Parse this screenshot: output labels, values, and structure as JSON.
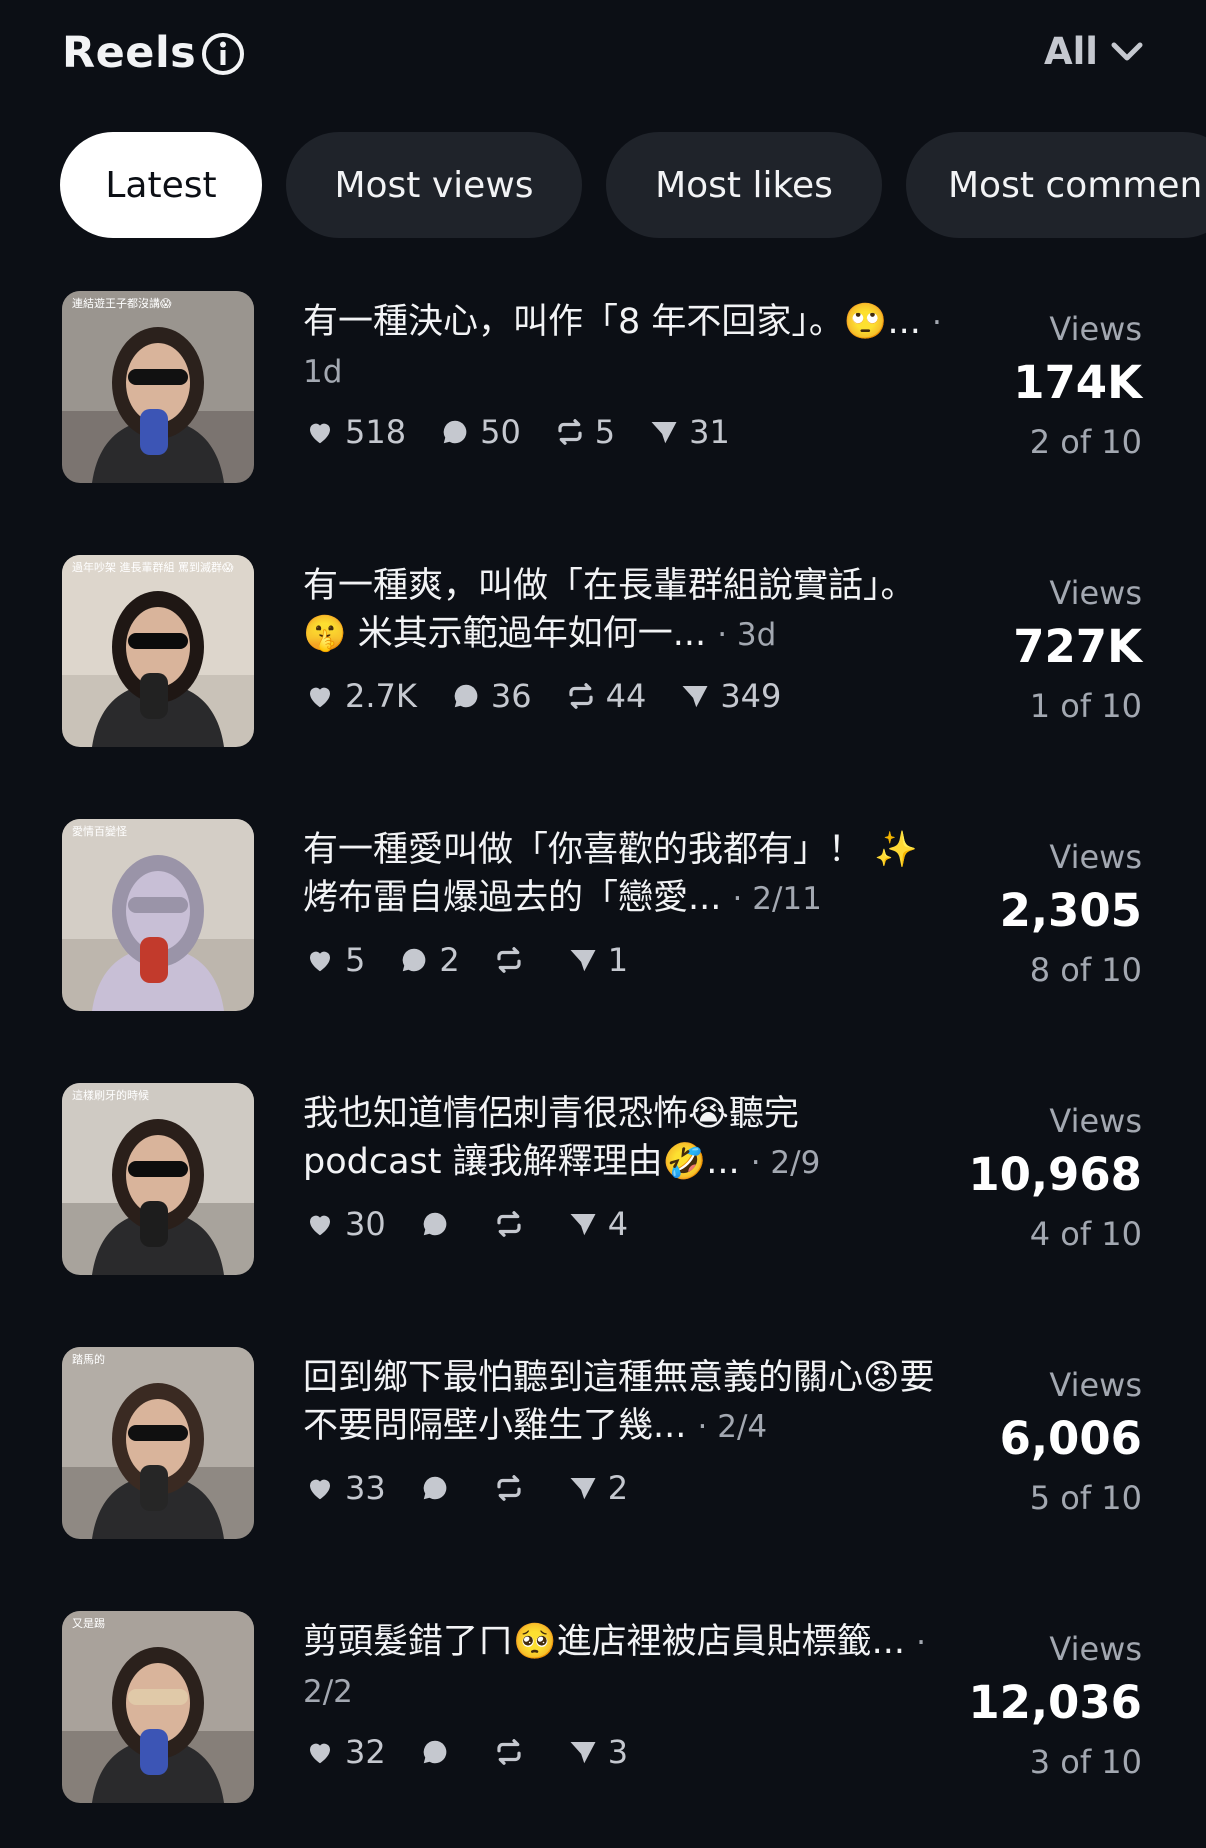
{
  "header": {
    "title": "Reels",
    "filter_label": "All"
  },
  "tabs": [
    {
      "label": "Latest",
      "active": true
    },
    {
      "label": "Most views",
      "active": false
    },
    {
      "label": "Most likes",
      "active": false
    },
    {
      "label": "Most commen",
      "active": false
    }
  ],
  "labels": {
    "views": "Views"
  },
  "reels": [
    {
      "caption": "有一種決心，叫作「8 年不回家」。🙄...",
      "date": "· 1d",
      "likes": "518",
      "comments": "50",
      "reposts": "5",
      "shares": "31",
      "views": "174K",
      "rank": "2 of 10"
    },
    {
      "caption": "有一種爽，叫做「在長輩群組說實話」。 🤫 米其示範過年如何一...",
      "date": "· 3d",
      "likes": "2.7K",
      "comments": "36",
      "reposts": "44",
      "shares": "349",
      "views": "727K",
      "rank": "1 of 10"
    },
    {
      "caption": "有一種愛叫做「你喜歡的我都有」！ ✨ 烤布雷自爆過去的「戀愛...",
      "date": "· 2/11",
      "likes": "5",
      "comments": "2",
      "reposts": "",
      "shares": "1",
      "views": "2,305",
      "rank": "8 of 10"
    },
    {
      "caption": "我也知道情侶刺青很恐怖😭聽完 podcast 讓我解釋理由🤣...",
      "date": "· 2/9",
      "likes": "30",
      "comments": "",
      "reposts": "",
      "shares": "4",
      "views": "10,968",
      "rank": "4 of 10"
    },
    {
      "caption": "回到鄉下最怕聽到這種無意義的關心😡要不要問隔壁小雞生了幾...",
      "date": "· 2/4",
      "likes": "33",
      "comments": "",
      "reposts": "",
      "shares": "2",
      "views": "6,006",
      "rank": "5 of 10"
    },
    {
      "caption": "剪頭髮錯了ㄇ🥺進店裡被店員貼標籤...",
      "date": "· 2/2",
      "likes": "32",
      "comments": "",
      "reposts": "",
      "shares": "3",
      "views": "12,036",
      "rank": "3 of 10"
    }
  ],
  "thumbnails": [
    {
      "overlay": "連結遊王子都沒講😱"
    },
    {
      "overlay": "過年吵架 進長輩群組 罵到滅群😱"
    },
    {
      "overlay": "愛情百變怪"
    },
    {
      "overlay": "這樣刷牙的時候"
    },
    {
      "overlay": "踏馬的"
    },
    {
      "overlay": "又是踢"
    }
  ],
  "colors": {
    "background": "#0c0f15",
    "tab_inactive": "#1f232a",
    "tab_active": "#ffffff",
    "muted_text": "#a3a8b1"
  }
}
